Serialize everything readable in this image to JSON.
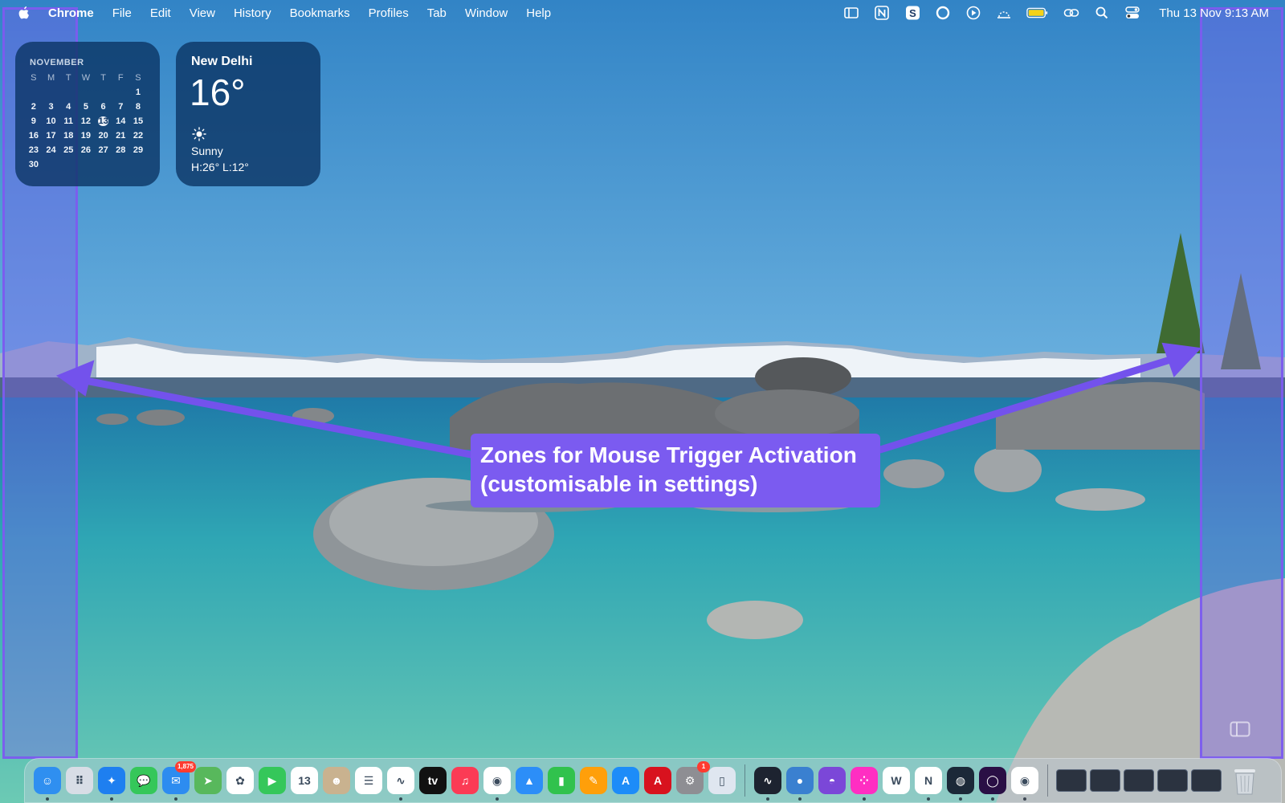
{
  "menubar": {
    "app_name": "Chrome",
    "menus": [
      "File",
      "Edit",
      "View",
      "History",
      "Bookmarks",
      "Profiles",
      "Tab",
      "Window",
      "Help"
    ],
    "status_icons": [
      "sidebar-icon",
      "notion-icon",
      "skype-icon",
      "circle-icon",
      "play-circle-icon",
      "weather-icon",
      "battery-icon",
      "link-icon",
      "search-icon",
      "control-center-icon"
    ],
    "clock": "Thu 13 Nov  9:13 AM",
    "battery_color": "#f5d218"
  },
  "calendar_widget": {
    "month": "NOVEMBER",
    "weekdays": [
      "S",
      "M",
      "T",
      "W",
      "T",
      "F",
      "S"
    ],
    "weeks": [
      [
        "",
        "",
        "",
        "",
        "",
        "",
        "1"
      ],
      [
        "2",
        "3",
        "4",
        "5",
        "6",
        "7",
        "8"
      ],
      [
        "9",
        "10",
        "11",
        "12",
        "13",
        "14",
        "15"
      ],
      [
        "16",
        "17",
        "18",
        "19",
        "20",
        "21",
        "22"
      ],
      [
        "23",
        "24",
        "25",
        "26",
        "27",
        "28",
        "29"
      ],
      [
        "30",
        "",
        "",
        "",
        "",
        "",
        ""
      ]
    ],
    "today": "13"
  },
  "weather_widget": {
    "city": "New Delhi",
    "temperature": "16°",
    "condition_icon": "sun-icon",
    "condition": "Sunny",
    "high_low": "H:26° L:12°"
  },
  "annotation": {
    "line1": "Zones for Mouse Trigger Activation",
    "line2": "(customisable in settings)",
    "zone_color": "#7c5cee",
    "callout_color": "#7b5bf0"
  },
  "dock": {
    "apps": [
      {
        "name": "finder",
        "icon": "finder-icon",
        "color": "#2f8ff0",
        "glyph": "☺",
        "dot": true
      },
      {
        "name": "launchpad",
        "icon": "launchpad-icon",
        "color": "#d8dde6",
        "glyph": "⠿",
        "dot": false
      },
      {
        "name": "safari",
        "icon": "safari-icon",
        "color": "#1e7ff0",
        "glyph": "✦",
        "dot": true
      },
      {
        "name": "messages",
        "icon": "messages-icon",
        "color": "#35c75a",
        "glyph": "💬",
        "dot": false
      },
      {
        "name": "mail",
        "icon": "mail-icon",
        "color": "#2d8cf0",
        "glyph": "✉",
        "dot": true,
        "badge": "1,875"
      },
      {
        "name": "maps",
        "icon": "maps-icon",
        "color": "#58b85c",
        "glyph": "➤",
        "dot": false
      },
      {
        "name": "photos",
        "icon": "photos-icon",
        "color": "#ffffff",
        "glyph": "✿",
        "dot": false
      },
      {
        "name": "facetime",
        "icon": "facetime-icon",
        "color": "#35c75a",
        "glyph": "▶",
        "dot": false
      },
      {
        "name": "calendar",
        "icon": "calendar-icon",
        "color": "#ffffff",
        "glyph": "13",
        "dot": false
      },
      {
        "name": "contacts",
        "icon": "contacts-icon",
        "color": "#c9b28f",
        "glyph": "☻",
        "dot": false
      },
      {
        "name": "reminders",
        "icon": "reminders-icon",
        "color": "#ffffff",
        "glyph": "☰",
        "dot": false
      },
      {
        "name": "freeform",
        "icon": "freeform-icon",
        "color": "#ffffff",
        "glyph": "∿",
        "dot": true
      },
      {
        "name": "apple-tv",
        "icon": "apple-tv-icon",
        "color": "#111111",
        "glyph": "tv",
        "dot": false
      },
      {
        "name": "music",
        "icon": "music-icon",
        "color": "#fb3b55",
        "glyph": "♫",
        "dot": false
      },
      {
        "name": "chrome",
        "icon": "chrome-icon",
        "color": "#ffffff",
        "glyph": "◉",
        "dot": true
      },
      {
        "name": "keynote",
        "icon": "keynote-icon",
        "color": "#2c8ef8",
        "glyph": "▲",
        "dot": false
      },
      {
        "name": "numbers",
        "icon": "numbers-icon",
        "color": "#31c24d",
        "glyph": "▮",
        "dot": false
      },
      {
        "name": "pages",
        "icon": "pages-icon",
        "color": "#ff9f0a",
        "glyph": "✎",
        "dot": false
      },
      {
        "name": "app-store",
        "icon": "app-store-icon",
        "color": "#1d8cf8",
        "glyph": "A",
        "dot": false
      },
      {
        "name": "autocad",
        "icon": "autocad-icon",
        "color": "#d8121e",
        "glyph": "A",
        "dot": false
      },
      {
        "name": "system-settings",
        "icon": "settings-icon",
        "color": "#8e8e93",
        "glyph": "⚙",
        "dot": false,
        "badge": "1"
      },
      {
        "name": "simulator",
        "icon": "simulator-icon",
        "color": "#dfe6f0",
        "glyph": "▯",
        "dot": false
      }
    ],
    "apps2": [
      {
        "name": "activity-monitor",
        "icon": "activity-monitor-icon",
        "color": "#1d2330",
        "glyph": "∿",
        "dot": true
      },
      {
        "name": "disk-utility",
        "icon": "disk-icon",
        "color": "#3a80d0",
        "glyph": "●",
        "dot": true
      },
      {
        "name": "github",
        "icon": "github-icon",
        "color": "#7b47d8",
        "glyph": "◓",
        "dot": false
      },
      {
        "name": "dots-app",
        "icon": "dots-app-icon",
        "color": "#ff2ec2",
        "glyph": "⁘",
        "dot": true
      },
      {
        "name": "word",
        "icon": "word-icon",
        "color": "#ffffff",
        "glyph": "W",
        "dot": false
      },
      {
        "name": "notion",
        "icon": "notion-app-icon",
        "color": "#ffffff",
        "glyph": "N",
        "dot": true
      },
      {
        "name": "steam",
        "icon": "steam-icon",
        "color": "#1b2838",
        "glyph": "◍",
        "dot": true
      },
      {
        "name": "orb-app",
        "icon": "orb-icon",
        "color": "#2a0f45",
        "glyph": "◯",
        "dot": true
      },
      {
        "name": "chrome-beta",
        "icon": "chrome-beta-icon",
        "color": "#ffffff",
        "glyph": "◉",
        "dot": true
      }
    ],
    "window_thumbnails": 5,
    "trash_icon": "trash-icon"
  }
}
